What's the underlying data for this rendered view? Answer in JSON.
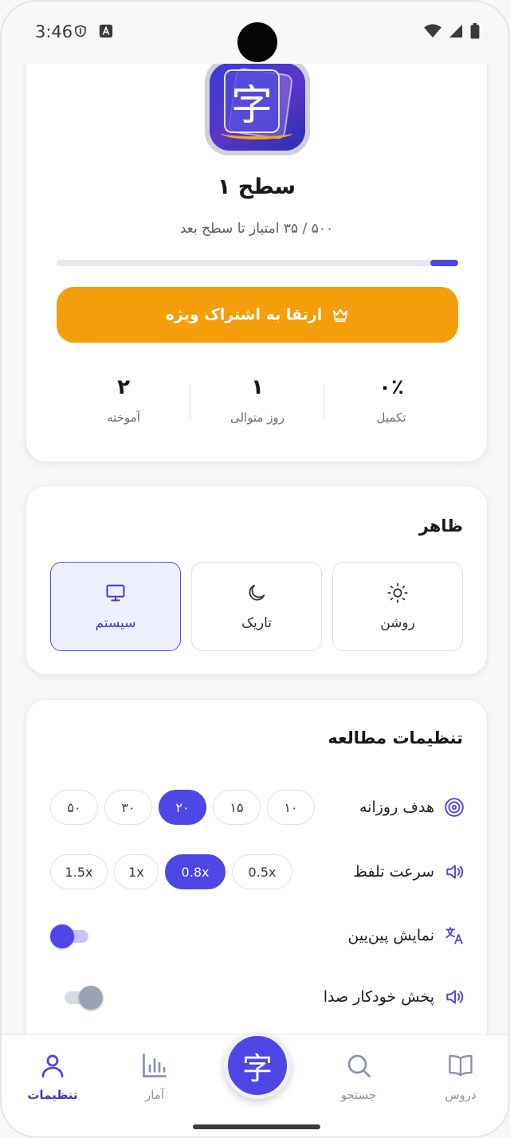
{
  "status_bar": {
    "time": "3:46"
  },
  "profile": {
    "level_title": "سطح ۱",
    "level_subtitle": "۵۰۰ / ۳۵ امتیاز تا سطح بعد",
    "progress": 0.07,
    "upgrade_label": "ارتقا به اشتراک ویژه",
    "app_icon_glyph": "字",
    "stats": [
      {
        "value": "۰٪",
        "label": "تکمیل"
      },
      {
        "value": "۱",
        "label": "روز متوالی"
      },
      {
        "value": "۲",
        "label": "آموخته"
      }
    ]
  },
  "appearance": {
    "title": "ظاهر",
    "themes": [
      {
        "label": "روشن",
        "icon": "sun-icon",
        "active": false
      },
      {
        "label": "تاریک",
        "icon": "moon-icon",
        "active": false
      },
      {
        "label": "سیستم",
        "icon": "monitor-icon",
        "active": true
      }
    ]
  },
  "study": {
    "title": "تنظیمات مطالعه",
    "daily_goal": {
      "label": "هدف روزانه",
      "options": [
        "۱۰",
        "۱۵",
        "۲۰",
        "۳۰",
        "۵۰"
      ],
      "selected": "۲۰"
    },
    "speech_speed": {
      "label": "سرعت تلفظ",
      "options": [
        "0.5x",
        "0.8x",
        "1x",
        "1.5x"
      ],
      "selected": "0.8x"
    },
    "show_pinyin": {
      "label": "نمایش پین‌یین",
      "on": true
    },
    "autoplay_audio": {
      "label": "پخش خودکار صدا",
      "on": false
    }
  },
  "nav": {
    "items": [
      {
        "label": "دروس",
        "icon": "book-icon",
        "active": false
      },
      {
        "label": "جستجو",
        "icon": "search-icon",
        "active": false
      },
      {
        "label": "آمار",
        "icon": "bar-chart-icon",
        "active": false
      },
      {
        "label": "تنظیمات",
        "icon": "user-icon",
        "active": true
      }
    ],
    "center_glyph": "字"
  },
  "colors": {
    "primary": "#4f46e5",
    "accent": "#f59e0b",
    "inactive_nav": "#8a93a8"
  }
}
